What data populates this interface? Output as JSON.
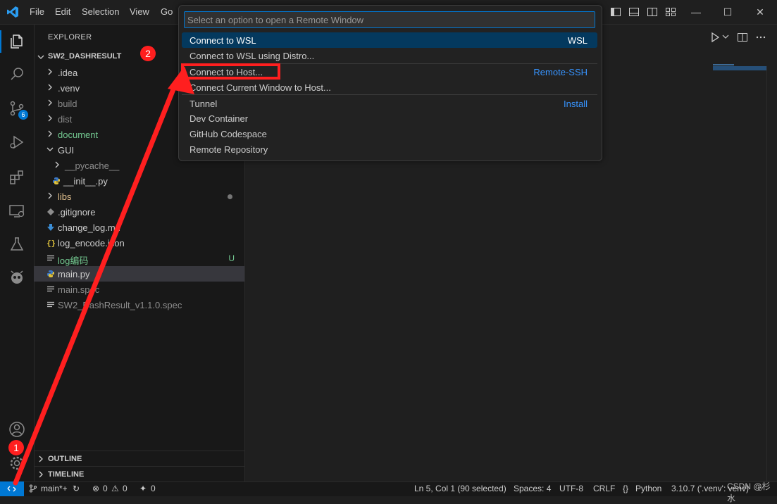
{
  "titlebar": {
    "menus": [
      "File",
      "Edit",
      "Selection",
      "View",
      "Go"
    ]
  },
  "activity_bar": {
    "scm_badge": "6",
    "icons": [
      "explorer-icon",
      "search-icon",
      "source-control-icon",
      "run-debug-icon",
      "extensions-icon",
      "remote-explorer-icon",
      "testing-icon",
      "platformio-icon",
      "accounts-icon",
      "manage-gear-icon"
    ]
  },
  "explorer": {
    "title": "EXPLORER",
    "root": "SW2_DASHRESULT",
    "items": [
      {
        "label": ".idea",
        "type": "folder",
        "color": "#cccccc"
      },
      {
        "label": ".venv",
        "type": "folder",
        "color": "#cccccc"
      },
      {
        "label": "build",
        "type": "folder",
        "color": "#8c8c8c"
      },
      {
        "label": "dist",
        "type": "folder",
        "color": "#8c8c8c"
      },
      {
        "label": "document",
        "type": "folder",
        "color": "#73c991"
      },
      {
        "label": "GUI",
        "type": "folder-open",
        "color": "#cccccc"
      },
      {
        "label": "__pycache__",
        "type": "folder",
        "color": "#8c8c8c"
      },
      {
        "label": "__init__.py",
        "type": "python",
        "color": "#cccccc"
      },
      {
        "label": "libs",
        "type": "folder",
        "color": "#e2c08d",
        "marker": "dot"
      },
      {
        "label": ".gitignore",
        "type": "gitignore",
        "color": "#cccccc"
      },
      {
        "label": "change_log.md",
        "type": "markdown",
        "color": "#cccccc"
      },
      {
        "label": "log_encode.json",
        "type": "json",
        "color": "#cccccc"
      },
      {
        "label": "log编码",
        "type": "text",
        "color": "#73c991",
        "marker": "U"
      },
      {
        "label": "main.py",
        "type": "python",
        "color": "#cccccc"
      },
      {
        "label": "main.spec",
        "type": "text",
        "color": "#8c8c8c"
      },
      {
        "label": "SW2_DashResult_v1.1.0.spec",
        "type": "text",
        "color": "#8c8c8c"
      }
    ],
    "outline": "OUTLINE",
    "timeline": "TIMELINE"
  },
  "quick_pick": {
    "placeholder": "Select an option to open a Remote Window",
    "items": [
      {
        "label": "Connect to WSL",
        "detail": "WSL",
        "active": true
      },
      {
        "label": "Connect to WSL using Distro...",
        "detail": ""
      },
      {
        "label": "Connect to Host...",
        "detail": "Remote-SSH"
      },
      {
        "label": "Connect Current Window to Host...",
        "detail": ""
      },
      {
        "label": "Tunnel",
        "detail": "Install"
      },
      {
        "label": "Dev Container",
        "detail": ""
      },
      {
        "label": "GitHub Codespace",
        "detail": ""
      },
      {
        "label": "Remote Repository",
        "detail": ""
      }
    ]
  },
  "annotations": {
    "step1": "1",
    "step2": "2",
    "arrow_color": "#ff1f1f"
  },
  "status_bar": {
    "branch": "main*+",
    "errors": "0",
    "warnings": "0",
    "ports": "0",
    "position": "Ln 5, Col 1 (90 selected)",
    "spaces": "Spaces: 4",
    "encoding": "UTF-8",
    "eol": "CRLF",
    "language": "Python",
    "interpreter": "3.10.7 ('.venv': venv)",
    "watermark": "CSDN @杉水"
  },
  "colors": {
    "accent": "#0078d4",
    "background": "#1f1f1f",
    "sidebar": "#181818",
    "annotation": "#ff1f1f"
  }
}
